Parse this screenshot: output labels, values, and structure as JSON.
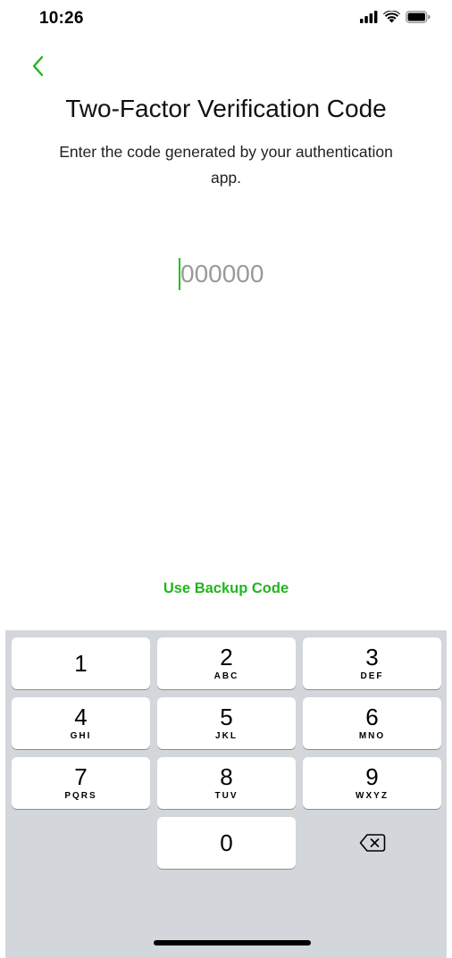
{
  "status_bar": {
    "time": "10:26"
  },
  "header": {
    "back_icon": "chevron-left-icon",
    "title": "Two-Factor Verification Code",
    "subtitle": "Enter the code generated by your authentication app."
  },
  "code_input": {
    "value": "",
    "placeholder": "000000"
  },
  "backup_link": {
    "label": "Use Backup Code"
  },
  "keyboard": {
    "keys": [
      {
        "digit": "1",
        "letters": ""
      },
      {
        "digit": "2",
        "letters": "ABC"
      },
      {
        "digit": "3",
        "letters": "DEF"
      },
      {
        "digit": "4",
        "letters": "GHI"
      },
      {
        "digit": "5",
        "letters": "JKL"
      },
      {
        "digit": "6",
        "letters": "MNO"
      },
      {
        "digit": "7",
        "letters": "PQRS"
      },
      {
        "digit": "8",
        "letters": "TUV"
      },
      {
        "digit": "9",
        "letters": "WXYZ"
      },
      {
        "digit": "0",
        "letters": ""
      }
    ],
    "delete_icon": "backspace-icon"
  },
  "colors": {
    "accent": "#22b51f",
    "keyboard_bg": "#d3d6db",
    "key_bg": "#ffffff"
  }
}
